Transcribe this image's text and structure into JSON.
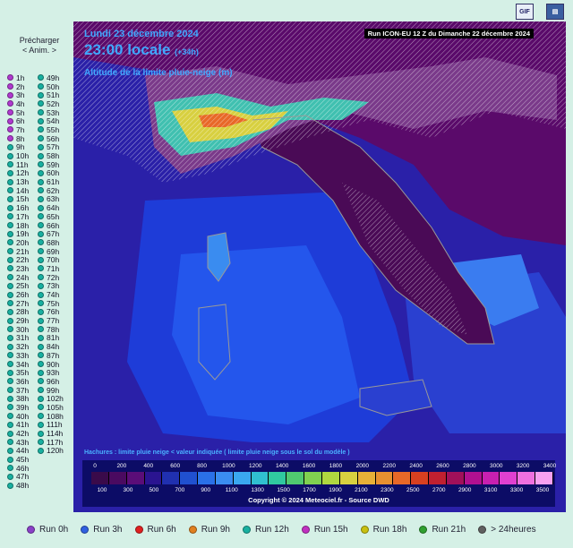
{
  "toolbar": {
    "gif_label": "GIF",
    "save_icon": "save-icon"
  },
  "preload": {
    "line1": "Précharger",
    "line2": "< Anim. >"
  },
  "runs_left": [
    {
      "label": "1h",
      "color": "#b03ad0"
    },
    {
      "label": "2h",
      "color": "#b03ad0"
    },
    {
      "label": "3h",
      "color": "#b03ad0"
    },
    {
      "label": "4h",
      "color": "#b03ad0"
    },
    {
      "label": "5h",
      "color": "#b03ad0"
    },
    {
      "label": "6h",
      "color": "#b03ad0"
    },
    {
      "label": "7h",
      "color": "#b03ad0"
    },
    {
      "label": "8h",
      "color": "#b03ad0"
    },
    {
      "label": "9h",
      "color": "#18b0a0"
    },
    {
      "label": "10h",
      "color": "#18b0a0"
    },
    {
      "label": "11h",
      "color": "#18b0a0"
    },
    {
      "label": "12h",
      "color": "#18b0a0"
    },
    {
      "label": "13h",
      "color": "#18b0a0"
    },
    {
      "label": "14h",
      "color": "#18b0a0"
    },
    {
      "label": "15h",
      "color": "#18b0a0"
    },
    {
      "label": "16h",
      "color": "#18b0a0"
    },
    {
      "label": "17h",
      "color": "#18b0a0"
    },
    {
      "label": "18h",
      "color": "#18b0a0"
    },
    {
      "label": "19h",
      "color": "#18b0a0"
    },
    {
      "label": "20h",
      "color": "#18b0a0"
    },
    {
      "label": "21h",
      "color": "#18b0a0"
    },
    {
      "label": "22h",
      "color": "#18b0a0"
    },
    {
      "label": "23h",
      "color": "#18b0a0"
    },
    {
      "label": "24h",
      "color": "#18b0a0"
    },
    {
      "label": "25h",
      "color": "#18b0a0"
    },
    {
      "label": "26h",
      "color": "#18b0a0"
    },
    {
      "label": "27h",
      "color": "#18b0a0"
    },
    {
      "label": "28h",
      "color": "#18b0a0"
    },
    {
      "label": "29h",
      "color": "#18b0a0"
    },
    {
      "label": "30h",
      "color": "#18b0a0"
    },
    {
      "label": "31h",
      "color": "#18b0a0"
    },
    {
      "label": "32h",
      "color": "#18b0a0"
    },
    {
      "label": "33h",
      "color": "#18b0a0"
    },
    {
      "label": "34h",
      "color": "#18b0a0"
    },
    {
      "label": "35h",
      "color": "#18b0a0"
    },
    {
      "label": "36h",
      "color": "#18b0a0"
    },
    {
      "label": "37h",
      "color": "#18b0a0"
    },
    {
      "label": "38h",
      "color": "#18b0a0"
    },
    {
      "label": "39h",
      "color": "#18b0a0"
    },
    {
      "label": "40h",
      "color": "#18b0a0"
    },
    {
      "label": "41h",
      "color": "#18b0a0"
    },
    {
      "label": "42h",
      "color": "#18b0a0"
    },
    {
      "label": "43h",
      "color": "#18b0a0"
    },
    {
      "label": "44h",
      "color": "#18b0a0"
    },
    {
      "label": "45h",
      "color": "#18b0a0"
    },
    {
      "label": "46h",
      "color": "#18b0a0"
    },
    {
      "label": "47h",
      "color": "#18b0a0"
    },
    {
      "label": "48h",
      "color": "#18b0a0"
    }
  ],
  "runs_right": [
    {
      "label": "49h",
      "color": "#18b0a0"
    },
    {
      "label": "50h",
      "color": "#18b0a0"
    },
    {
      "label": "51h",
      "color": "#18b0a0"
    },
    {
      "label": "52h",
      "color": "#18b0a0"
    },
    {
      "label": "53h",
      "color": "#18b0a0"
    },
    {
      "label": "54h",
      "color": "#18b0a0"
    },
    {
      "label": "55h",
      "color": "#18b0a0"
    },
    {
      "label": "56h",
      "color": "#18b0a0"
    },
    {
      "label": "57h",
      "color": "#18b0a0"
    },
    {
      "label": "58h",
      "color": "#18b0a0"
    },
    {
      "label": "59h",
      "color": "#18b0a0"
    },
    {
      "label": "60h",
      "color": "#18b0a0"
    },
    {
      "label": "61h",
      "color": "#18b0a0"
    },
    {
      "label": "62h",
      "color": "#18b0a0"
    },
    {
      "label": "63h",
      "color": "#18b0a0"
    },
    {
      "label": "64h",
      "color": "#18b0a0"
    },
    {
      "label": "65h",
      "color": "#18b0a0"
    },
    {
      "label": "66h",
      "color": "#18b0a0"
    },
    {
      "label": "67h",
      "color": "#18b0a0"
    },
    {
      "label": "68h",
      "color": "#18b0a0"
    },
    {
      "label": "69h",
      "color": "#18b0a0"
    },
    {
      "label": "70h",
      "color": "#18b0a0"
    },
    {
      "label": "71h",
      "color": "#18b0a0"
    },
    {
      "label": "72h",
      "color": "#18b0a0"
    },
    {
      "label": "73h",
      "color": "#18b0a0"
    },
    {
      "label": "74h",
      "color": "#18b0a0"
    },
    {
      "label": "75h",
      "color": "#18b0a0"
    },
    {
      "label": "76h",
      "color": "#18b0a0"
    },
    {
      "label": "77h",
      "color": "#18b0a0"
    },
    {
      "label": "78h",
      "color": "#18b0a0"
    },
    {
      "label": "81h",
      "color": "#18b0a0"
    },
    {
      "label": "84h",
      "color": "#18b0a0"
    },
    {
      "label": "87h",
      "color": "#18b0a0"
    },
    {
      "label": "90h",
      "color": "#18b0a0"
    },
    {
      "label": "93h",
      "color": "#18b0a0"
    },
    {
      "label": "96h",
      "color": "#18b0a0"
    },
    {
      "label": "99h",
      "color": "#18b0a0"
    },
    {
      "label": "102h",
      "color": "#18b0a0"
    },
    {
      "label": "105h",
      "color": "#18b0a0"
    },
    {
      "label": "108h",
      "color": "#18b0a0"
    },
    {
      "label": "111h",
      "color": "#18b0a0"
    },
    {
      "label": "114h",
      "color": "#18b0a0"
    },
    {
      "label": "117h",
      "color": "#18b0a0"
    },
    {
      "label": "120h",
      "color": "#18b0a0"
    }
  ],
  "map": {
    "date": "Lundi 23 décembre 2024",
    "time": "23:00 locale",
    "offset": "(+34h)",
    "parameter": "Altitude de la limite pluie-neige (m)",
    "run_info": "Run ICON-EU 12 Z du Dimanche 22 décembre 2024",
    "note": "Hachures : limite pluie neige < valeur indiquée ( limite pluie neige sous le sol du modèle )",
    "copyright": "Copyright © 2024 Meteociel.fr - Source DWD"
  },
  "legend": {
    "top_labels": [
      "0",
      "200",
      "400",
      "600",
      "800",
      "1000",
      "1200",
      "1400",
      "1600",
      "1800",
      "2000",
      "2200",
      "2400",
      "2600",
      "2800",
      "3000",
      "3200",
      "3400"
    ],
    "bottom_labels": [
      "100",
      "300",
      "500",
      "700",
      "900",
      "1100",
      "1300",
      "1500",
      "1700",
      "1900",
      "2100",
      "2300",
      "2500",
      "2700",
      "2900",
      "3100",
      "3300",
      "3500"
    ],
    "colors": [
      "#3a0a4a",
      "#4a0a60",
      "#5a0d78",
      "#2a1490",
      "#2030b0",
      "#2050d0",
      "#2a70e8",
      "#3a8cf0",
      "#3aa8f0",
      "#30c0d0",
      "#30c8a0",
      "#50c870",
      "#80d050",
      "#b0d840",
      "#d8d040",
      "#e8b038",
      "#e89030",
      "#e86828",
      "#d84020",
      "#c02030",
      "#a0105a",
      "#b01090",
      "#c820b0",
      "#e040d0",
      "#f070e0",
      "#f8a0f0"
    ]
  },
  "bottom_runs": [
    {
      "label": "Run 0h",
      "color": "#8a40c8"
    },
    {
      "label": "Run 3h",
      "color": "#3060e0"
    },
    {
      "label": "Run 6h",
      "color": "#e02020"
    },
    {
      "label": "Run 9h",
      "color": "#e08020"
    },
    {
      "label": "Run 12h",
      "color": "#18b0a0"
    },
    {
      "label": "Run 15h",
      "color": "#c030c0"
    },
    {
      "label": "Run 18h",
      "color": "#c8c010"
    },
    {
      "label": "Run 21h",
      "color": "#30a030"
    },
    {
      "label": "> 24heures",
      "color": "#606060"
    }
  ]
}
